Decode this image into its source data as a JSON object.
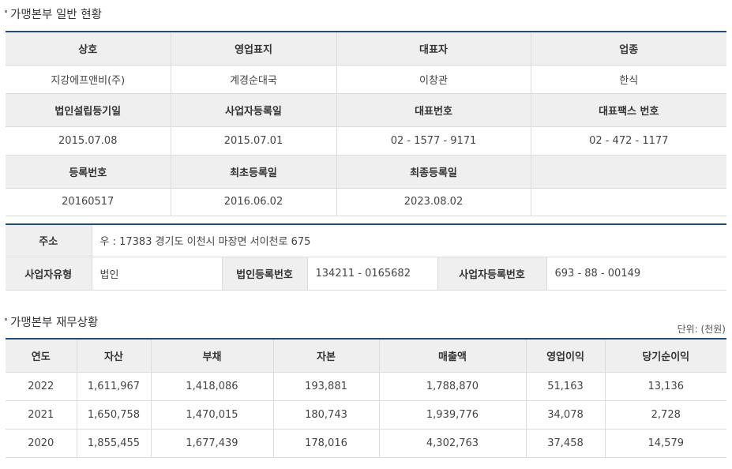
{
  "section1": {
    "title": "가맹본부 일반 현황"
  },
  "general": {
    "row1_headers": [
      "상호",
      "영업표지",
      "대표자",
      "업종"
    ],
    "row1_values": [
      "지강에프앤비(주)",
      "계경순대국",
      "이창관",
      "한식"
    ],
    "row2_headers": [
      "법인설립등기일",
      "사업자등록일",
      "대표번호",
      "대표팩스 번호"
    ],
    "row2_values": [
      "2015.07.08",
      "2015.07.01",
      "02 - 1577 - 9171",
      "02 - 472 - 1177"
    ],
    "row3_headers": [
      "등록번호",
      "최초등록일",
      "최종등록일",
      ""
    ],
    "row3_values": [
      "20160517",
      "2016.06.02",
      "2023.08.02",
      ""
    ]
  },
  "address": {
    "label": "주소",
    "value": "우 : 17383 경기도 이천시 마장면 서이천로 675",
    "biz_type_label": "사업자유형",
    "biz_type_value": "법인",
    "corp_no_label": "법인등록번호",
    "corp_no_value": "134211 - 0165682",
    "biz_no_label": "사업자등록번호",
    "biz_no_value": "693 - 88 - 00149"
  },
  "section2": {
    "title": "가맹본부 재무상황",
    "unit": "단위: (천원)"
  },
  "finance": {
    "headers": [
      "연도",
      "자산",
      "부채",
      "자본",
      "매출액",
      "영업이익",
      "당기순이익"
    ],
    "rows": [
      [
        "2022",
        "1,611,967",
        "1,418,086",
        "193,881",
        "1,788,870",
        "51,163",
        "13,136"
      ],
      [
        "2021",
        "1,650,758",
        "1,470,015",
        "180,743",
        "1,939,776",
        "34,078",
        "2,728"
      ],
      [
        "2020",
        "1,855,455",
        "1,677,439",
        "178,016",
        "4,302,763",
        "37,458",
        "14,579"
      ]
    ]
  }
}
